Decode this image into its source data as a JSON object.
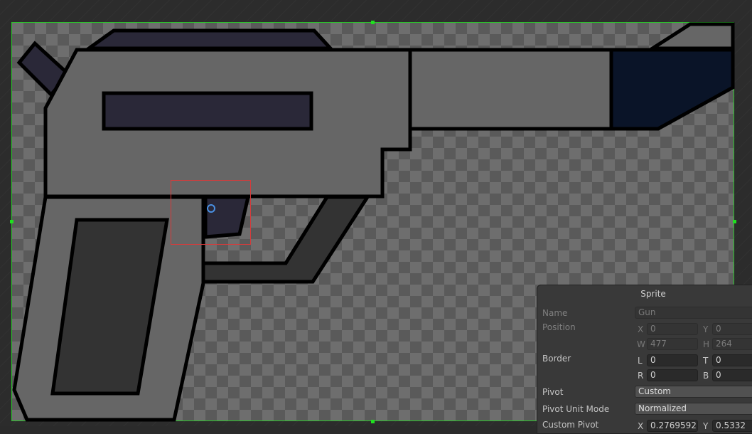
{
  "colors": {
    "sprite_border": "#29c629",
    "handle": "#1fe11f",
    "selection_box": "#d83a3a",
    "pivot_marker": "#4a90e2",
    "gun_body": "#666666",
    "gun_dark": "#2a2838",
    "gun_barrel_tip": "#0a1428"
  },
  "sprite_panel": {
    "title": "Sprite",
    "name_label": "Name",
    "name_value": "Gun",
    "position_label": "Position",
    "x_label": "X",
    "x_value": "0",
    "y_label": "Y",
    "y_value": "0",
    "w_label": "W",
    "w_value": "477",
    "h_label": "H",
    "h_value": "264",
    "border_label": "Border",
    "l_label": "L",
    "l_value": "0",
    "t_label": "T",
    "t_value": "0",
    "r_label": "R",
    "r_value": "0",
    "b_label": "B",
    "b_value": "0",
    "pivot_label": "Pivot",
    "pivot_value": "Custom",
    "pivot_unit_label": "Pivot Unit Mode",
    "pivot_unit_value": "Normalized",
    "custom_pivot_label": "Custom Pivot",
    "custom_pivot_x_label": "X",
    "custom_pivot_x_value": "0.2769592",
    "custom_pivot_y_label": "Y",
    "custom_pivot_y_value": "0.5332"
  }
}
